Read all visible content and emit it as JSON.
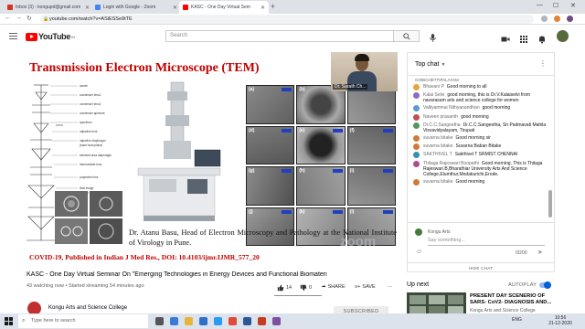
{
  "browser": {
    "tabs": [
      {
        "title": "Inbox (3) - kongupd@gmail.com",
        "active": false,
        "favicon_color": "#d93025"
      },
      {
        "title": "Login with Google - Zoom",
        "active": false,
        "favicon_color": "#4285f4"
      },
      {
        "title": "KASC - One Day Virtual Sem",
        "active": true,
        "favicon_color": "#ff0000"
      }
    ],
    "new_tab": "+",
    "url": "youtube.com/watch?v=ASiESSe9tTE"
  },
  "youtube": {
    "logo_word": "YouTube",
    "logo_region": "IN",
    "search_placeholder": "Search"
  },
  "video": {
    "slide_title": "Transmission Electron Microscope (TEM)",
    "diagram_labels": [
      "anode",
      "condenser lens1",
      "condenser lens2",
      "condenser aperture",
      "specimen",
      "objective lens",
      "objective diaphragm",
      "(back focal plane)",
      "selected area diaphragm",
      "intermediate lens",
      "projective lens",
      "final image",
      "screen"
    ],
    "panel_labels": [
      "(a)",
      "(b)",
      "(c)",
      "(d)",
      "(e)",
      "(f)",
      "(g)",
      "(h)",
      "(i)",
      "(j)",
      "(k)",
      "(l)"
    ],
    "webcam_name": "Dr. Sarath Ch...",
    "credit": "Dr. Atanu Basu, Head of Electron Microscopy and Pathology at the National Institute of Virology in Pune.",
    "citation": "COVID-19, Published in Indian J Med Res., DOI: 10.4103/ijmr.IJMR_577_20",
    "watermark": "zoom",
    "title": "KASC - One Day Virtual Seminar On \"Emerging Technologies in Energy Devices and Functional Biomateri",
    "stats": "43 watching now • Started streaming 54 minutes ago",
    "likes": "14",
    "dislikes": "0",
    "share": "SHARE",
    "save": "SAVE",
    "more": "⋯",
    "channel": "Kongu Arts and Science College",
    "subscribed": "SUBSCRIBED"
  },
  "chat": {
    "header": "Top chat",
    "pinned_fragment": "GOBICHETTIPALAYAM",
    "messages": [
      {
        "author": "Bhavani P",
        "text": "Good morning to all",
        "color": "#e8a33d"
      },
      {
        "author": "Kalai Selvi",
        "text": "good morning, this is Dr.V.Kalaiselvi from navarasam arts and science college for women",
        "color": "#8e6bbf"
      },
      {
        "author": "Valliyammai Nithyanandhan",
        "text": "good morning",
        "color": "#5a9bd5"
      },
      {
        "author": "Naveen prasanth",
        "text": "good morning",
        "color": "#c0504d"
      },
      {
        "author": "Dr.C.C.Sangeetha",
        "text": "Dr.C.C.Sangeetha, Sri Padmavati Mahila Visvavidyalayam, Tirupati",
        "color": "#4f9a5b"
      },
      {
        "author": "suvarna bitake",
        "text": "Good morning sir",
        "color": "#d07a3a"
      },
      {
        "author": "suvarna bitake",
        "text": "Suvarna Baban Bitake",
        "color": "#d07a3a"
      },
      {
        "author": "SAKTHIVEL T",
        "text": "Sakthivel T SRMIST CHENNAI",
        "color": "#3a8fb0"
      },
      {
        "author": "Thilaga Rajeswari Boopathi",
        "text": "Good morning. This is Thilaga Rajeswari.B,Bharathiar University Arts And Science College,Elumthur,Modakurichi,Erode.",
        "color": "#b04a8e"
      },
      {
        "author": "suvarna bitake",
        "text": "Good morning",
        "color": "#d07a3a"
      }
    ],
    "input_author": "Kongu Arts",
    "input_placeholder": "Say something...",
    "char_count": "0/200",
    "hide_chat": "HIDE CHAT"
  },
  "upnext": {
    "label": "Up next",
    "autoplay": "AUTOPLAY",
    "title": "PRESENT DAY SCENERIO OF SARS- CoV2- DIAGNOSIS AND...",
    "channel": "Kongu Arts and Science College"
  },
  "taskbar": {
    "search_placeholder": "Type here to search",
    "lang": "ENG",
    "time": "10:56",
    "date": "21-12-2020"
  }
}
